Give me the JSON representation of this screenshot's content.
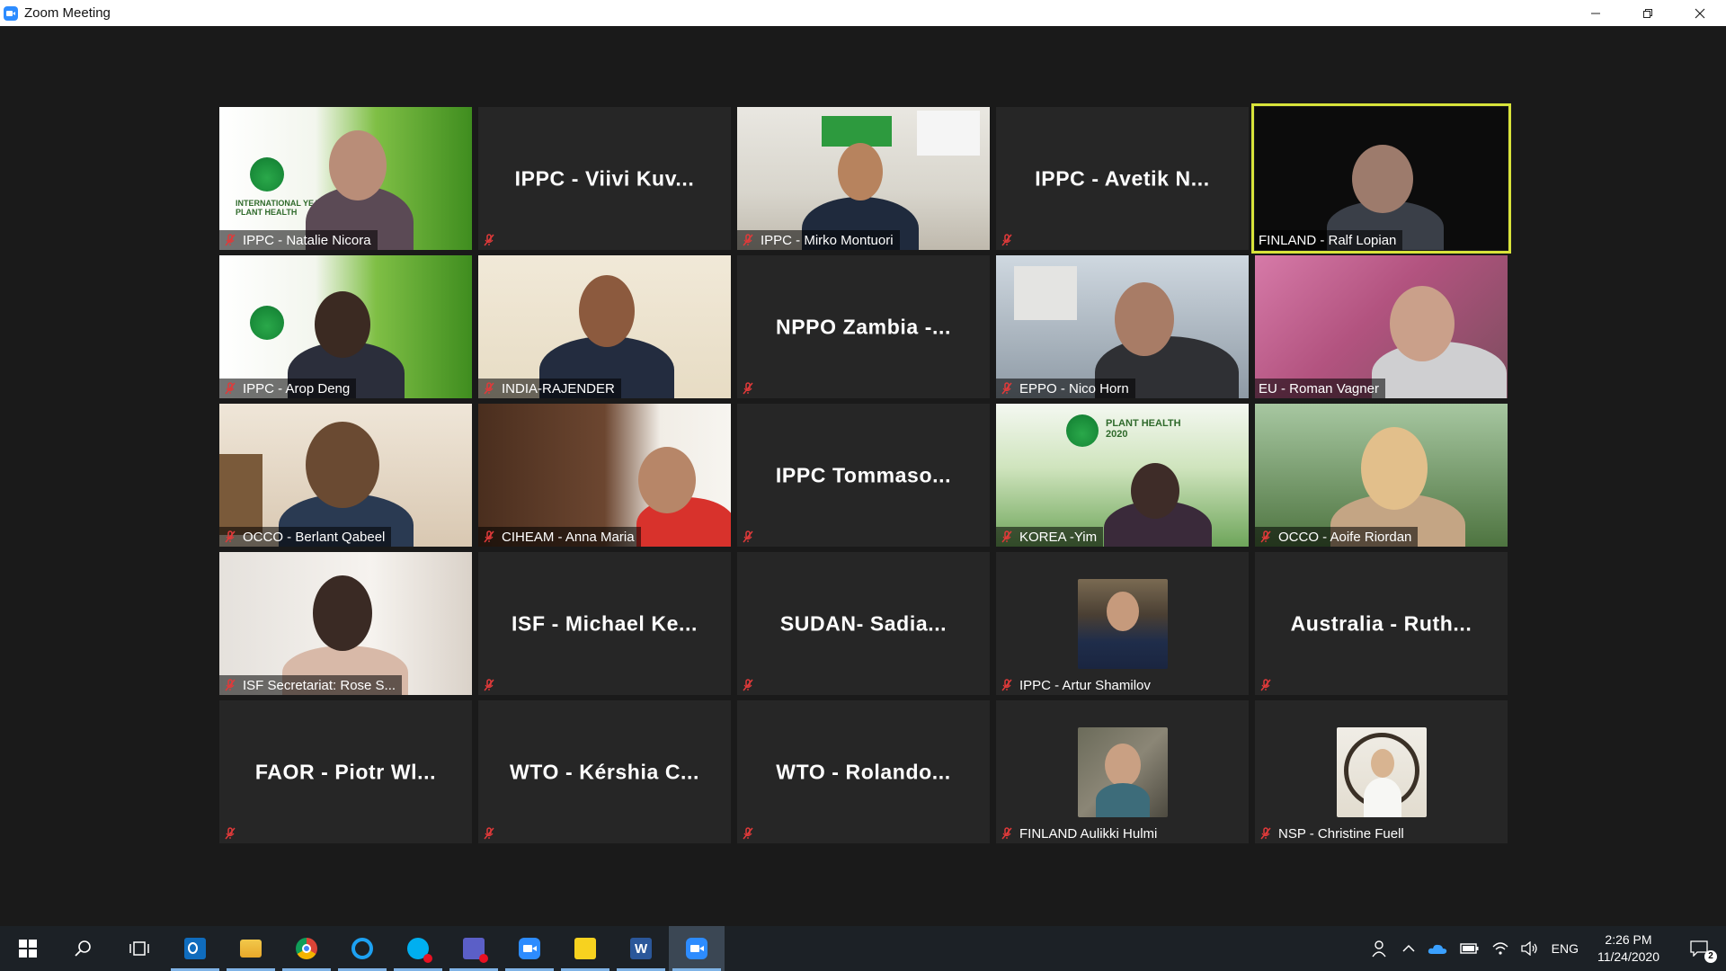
{
  "window": {
    "title": "Zoom Meeting",
    "controls": [
      "minimize-icon",
      "restore-icon",
      "close-icon"
    ]
  },
  "colors": {
    "active_speaker_border": "#d8e33a",
    "tile_background": "#262626",
    "meeting_background": "#1a1a1a",
    "mute_icon": "#e03a3a",
    "taskbar": "#1c2126"
  },
  "participants": [
    {
      "label": "IPPC - Natalie Nicora",
      "muted": true,
      "video": true
    },
    {
      "label": "",
      "display_name": "IPPC - Viivi Kuv...",
      "muted": true,
      "video": false
    },
    {
      "label": "IPPC - Mirko Montuori",
      "muted": true,
      "video": true
    },
    {
      "label": "",
      "display_name": "IPPC - Avetik N...",
      "muted": true,
      "video": false
    },
    {
      "label": "FINLAND - Ralf Lopian",
      "muted": false,
      "video": true,
      "active_speaker": true
    },
    {
      "label": "IPPC - Arop Deng",
      "muted": true,
      "video": true
    },
    {
      "label": "INDIA-RAJENDER",
      "muted": true,
      "video": true
    },
    {
      "label": "",
      "display_name": "NPPO Zambia -...",
      "muted": true,
      "video": false
    },
    {
      "label": "EPPO - Nico Horn",
      "muted": true,
      "video": true
    },
    {
      "label": "EU - Roman Vagner",
      "muted": false,
      "video": true
    },
    {
      "label": "OCCO - Berlant Qabeel",
      "muted": true,
      "video": true
    },
    {
      "label": "CIHEAM - Anna Maria",
      "muted": true,
      "video": true
    },
    {
      "label": "",
      "display_name": "IPPC Tommaso...",
      "muted": true,
      "video": false
    },
    {
      "label": "KOREA -Yim",
      "muted": true,
      "video": true
    },
    {
      "label": "OCCO - Aoife Riordan",
      "muted": true,
      "video": true
    },
    {
      "label": "ISF Secretariat: Rose S...",
      "muted": true,
      "video": true
    },
    {
      "label": "",
      "display_name": "ISF - Michael Ke...",
      "muted": true,
      "video": false
    },
    {
      "label": "",
      "display_name": "SUDAN- Sadia...",
      "muted": true,
      "video": false
    },
    {
      "label": "IPPC - Artur Shamilov",
      "muted": true,
      "video": false,
      "profile_photo": true
    },
    {
      "label": "",
      "display_name": "Australia - Ruth...",
      "muted": true,
      "video": false
    },
    {
      "label": "",
      "display_name": "FAOR - Piotr Wl...",
      "muted": true,
      "video": false
    },
    {
      "label": "",
      "display_name": "WTO - Kérshia C...",
      "muted": true,
      "video": false
    },
    {
      "label": "",
      "display_name": "WTO - Rolando...",
      "muted": true,
      "video": false
    },
    {
      "label": "FINLAND Aulikki Hulmi",
      "muted": true,
      "video": false,
      "profile_photo": true
    },
    {
      "label": "NSP - Christine Fuell",
      "muted": true,
      "video": false,
      "profile_photo": true
    }
  ],
  "taskbar": {
    "apps": [
      {
        "icon": "windows-start-icon",
        "running": false
      },
      {
        "icon": "search-icon",
        "running": false
      },
      {
        "icon": "task-view-icon",
        "running": false
      },
      {
        "icon": "outlook-icon",
        "running": true
      },
      {
        "icon": "file-explorer-icon",
        "running": true
      },
      {
        "icon": "chrome-icon",
        "running": true
      },
      {
        "icon": "internet-explorer-icon",
        "running": true
      },
      {
        "icon": "skype-icon",
        "running": true
      },
      {
        "icon": "teams-icon",
        "running": true
      },
      {
        "icon": "zoom-icon",
        "running": true
      },
      {
        "icon": "sticky-notes-icon",
        "running": true
      },
      {
        "icon": "word-icon",
        "running": true
      },
      {
        "icon": "zoom-meeting-icon",
        "running": true,
        "active": true
      }
    ],
    "tray": {
      "language": "ENG",
      "time": "2:26 PM",
      "date": "11/24/2020",
      "notification_count": "2"
    }
  }
}
